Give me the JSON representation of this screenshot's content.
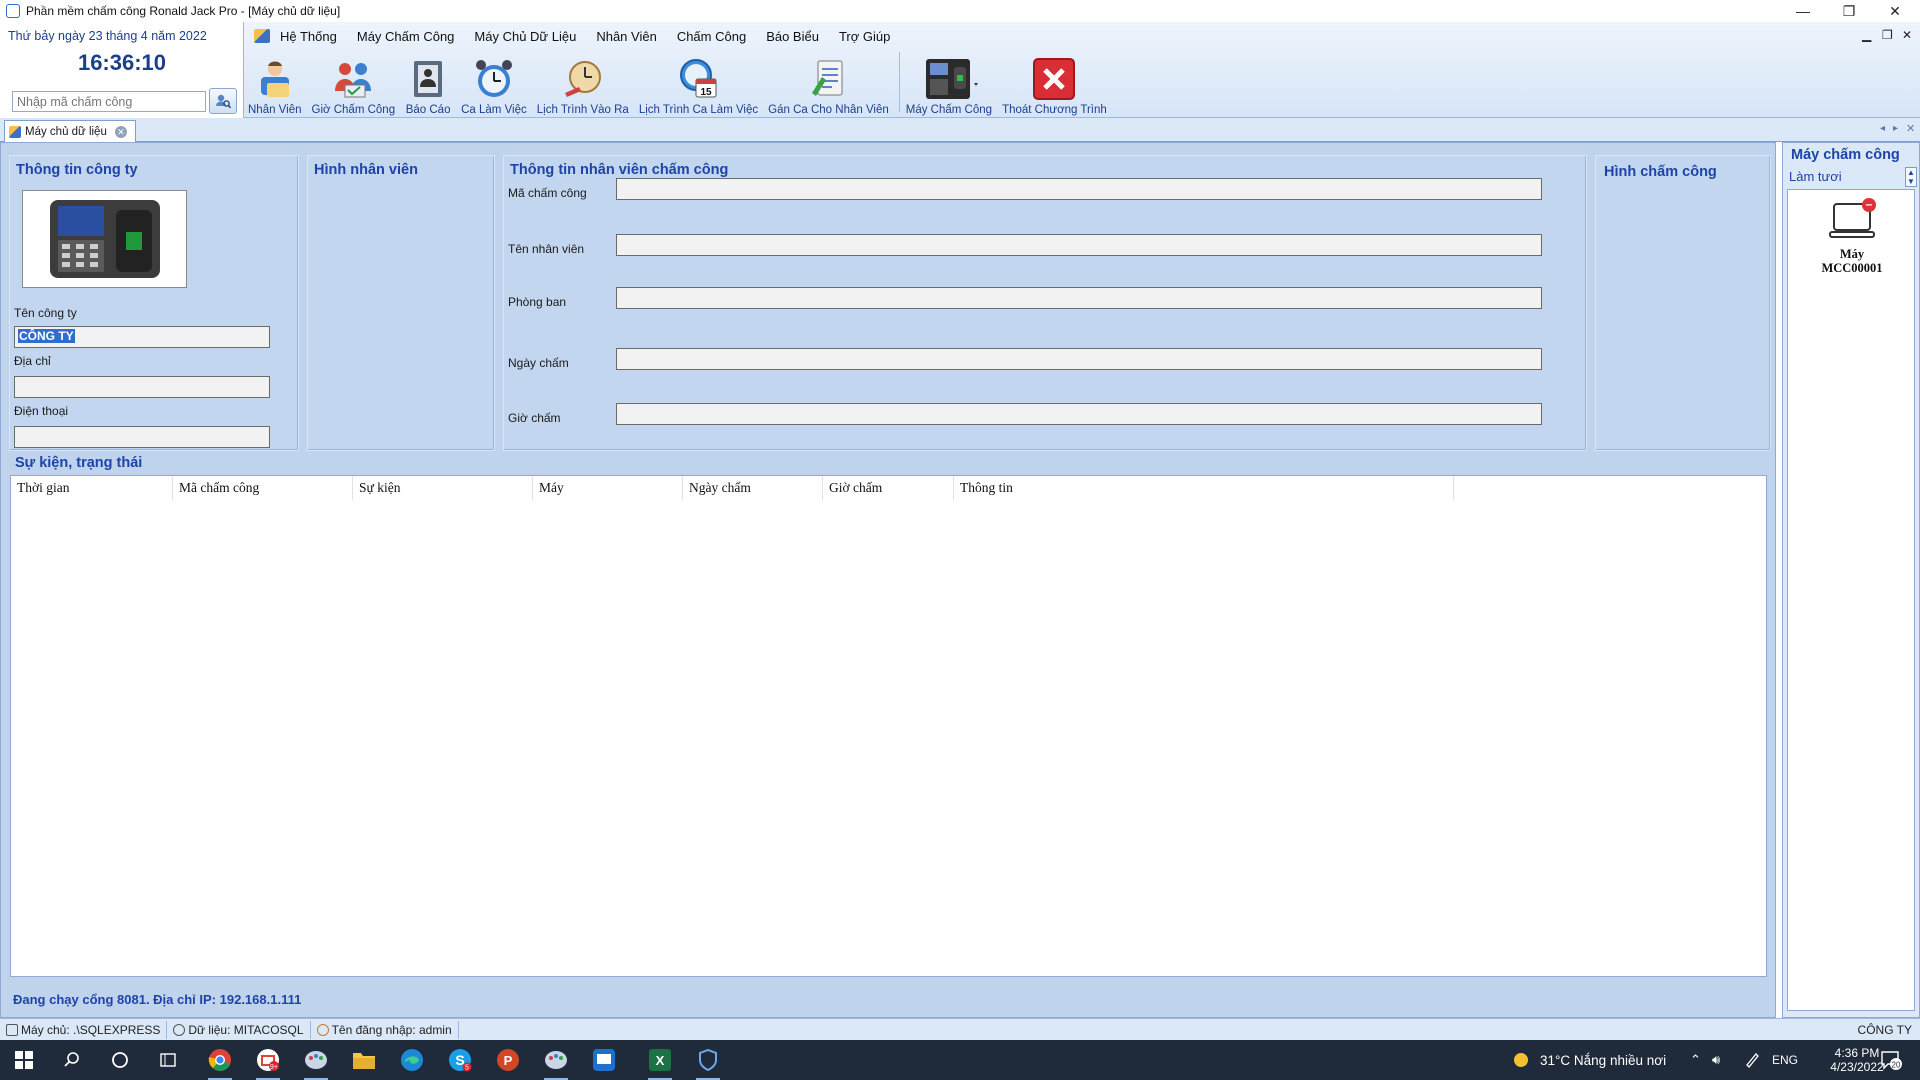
{
  "window": {
    "title": "Phần mềm chấm công Ronald Jack Pro - [Máy chủ dữ liệu]",
    "minimize_glyph": "—",
    "restore_glyph": "❐",
    "close_glyph": "✕"
  },
  "datepanel": {
    "date": "Thứ bảy ngày 23 tháng 4 năm 2022",
    "time": "16:36:10",
    "search_placeholder": "Nhập mã chấm công"
  },
  "menu": {
    "items": [
      "Hệ Thống",
      "Máy Chấm Công",
      "Máy Chủ Dữ Liệu",
      "Nhân Viên",
      "Chấm Công",
      "Báo Biểu",
      "Trợ Giúp"
    ]
  },
  "toolbar": {
    "buttons": [
      {
        "label": "Nhân Viên",
        "icon": "employee-icon"
      },
      {
        "label": "Giờ Chấm Công",
        "icon": "attendance-time-icon"
      },
      {
        "label": "Báo Cáo",
        "icon": "report-icon"
      },
      {
        "label": "Ca Làm Việc",
        "icon": "alarm-clock-icon"
      },
      {
        "label": "Lịch Trình Vào Ra",
        "icon": "schedule-in-out-icon"
      },
      {
        "label": "Lịch Trình Ca Làm Việc",
        "icon": "shift-calendar-icon"
      },
      {
        "label": "Gán Ca Cho Nhân Viên",
        "icon": "assign-shift-icon"
      },
      {
        "label": "Máy Chấm Công",
        "icon": "time-clock-machine-icon"
      },
      {
        "label": "Thoát Chương Trình",
        "icon": "exit-icon"
      }
    ],
    "calendar_day": "15"
  },
  "tab": {
    "label": "Máy chủ dữ liệu"
  },
  "company": {
    "title": "Thông tin công ty",
    "name_label": "Tên công ty",
    "name_value": "CÔNG TY",
    "address_label": "Địa chỉ",
    "address_value": "",
    "phone_label": "Điện thoại",
    "phone_value": ""
  },
  "employee_photo": {
    "title": "Hình nhân viên"
  },
  "attendance_info": {
    "title": "Thông tin nhân viên chấm công",
    "fields": [
      {
        "label": "Mã chấm công",
        "value": ""
      },
      {
        "label": "Tên nhân viên",
        "value": ""
      },
      {
        "label": "Phòng ban",
        "value": ""
      },
      {
        "label": "Ngày chấm",
        "value": ""
      },
      {
        "label": "Giờ chấm",
        "value": ""
      }
    ]
  },
  "attendance_photo": {
    "title": "Hình chấm công"
  },
  "events": {
    "title": "Sự kiện, trạng thái",
    "columns": [
      "Thời gian",
      "Mã chấm công",
      "Sự kiện",
      "Máy",
      "Ngày chấm",
      "Giờ chấm",
      "Thông tin"
    ],
    "rows": []
  },
  "server_status": "Đang chạy cổng 8081. Địa chỉ IP: 192.168.1.111",
  "side_panel": {
    "title": "Máy chấm công",
    "refresh": "Làm tươi",
    "machines": [
      {
        "line1": "Máy",
        "line2": "MCC00001",
        "status": "disconnected"
      }
    ]
  },
  "status_bar": {
    "server": "Máy chủ: .\\SQLEXPRESS",
    "database": "Dữ liệu: MITACOSQL",
    "user": "Tên đăng nhập: admin",
    "company": "CÔNG TY"
  },
  "taskbar": {
    "weather": "31°C  Nắng nhiều nơi",
    "language": "ENG",
    "time": "4:36 PM",
    "date": "4/23/2022",
    "notifications": "20",
    "badges": {
      "mail": "9+",
      "chat": "5"
    }
  },
  "colors": {
    "accent": "#1d44a8",
    "panel": "#c3d6ef",
    "taskbar": "#1f2a3a"
  }
}
